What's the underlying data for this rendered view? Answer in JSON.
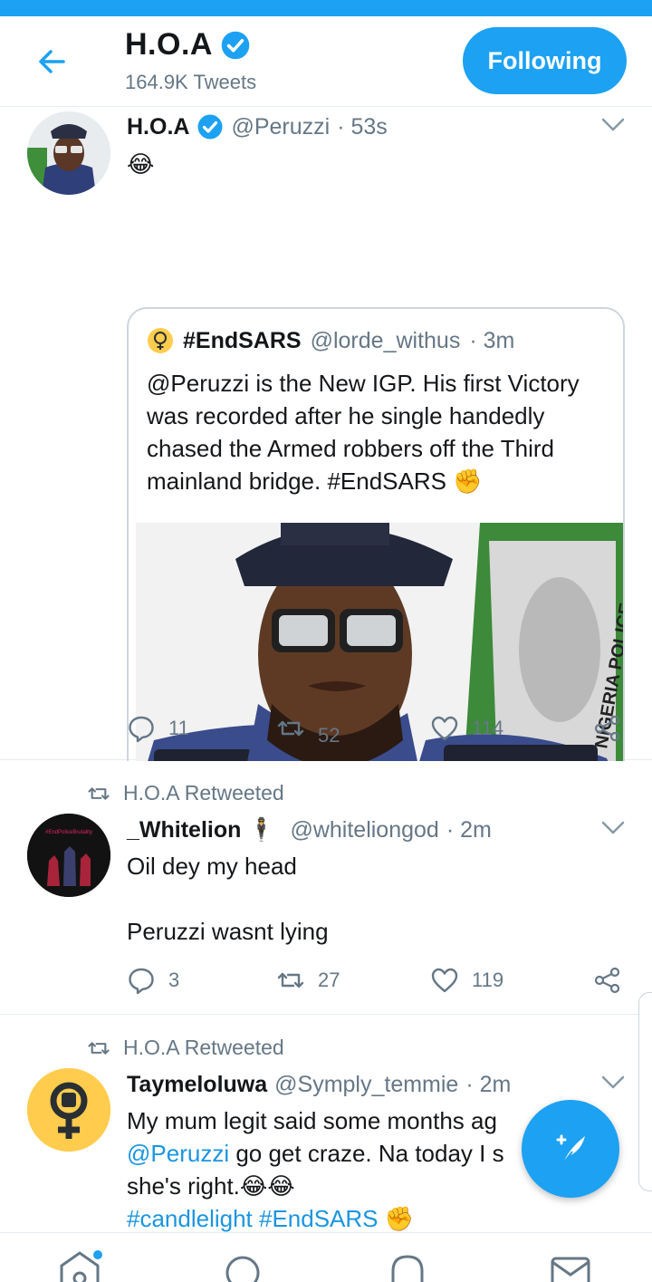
{
  "header": {
    "name": "H.O.A",
    "tweet_count": "164.9K Tweets",
    "follow_label": "Following"
  },
  "tweets": [
    {
      "name": "H.O.A",
      "handle": "@Peruzzi",
      "time": "· 53s",
      "text_emoji": "😂",
      "quote": {
        "name": "#EndSARS",
        "handle": "@lorde_withus",
        "time": "· 3m",
        "text": "@Peruzzi is the New IGP. His first Victory was recorded after he single handedly chased the Armed robbers off the Third mainland bridge. #EndSARS ✊",
        "image_text": "NIGERIA POLICE"
      },
      "replies": "11",
      "retweets": "52",
      "likes": "114"
    },
    {
      "retweeted_by": "H.O.A Retweeted",
      "name": "_Whitelion 🕴",
      "handle": "@whiteliongod",
      "time": "· 2m",
      "text_line1": "Oil dey my head",
      "text_line2": "Peruzzi wasnt lying",
      "avatar_text": "#EndPoliceBrutality",
      "replies": "3",
      "retweets": "27",
      "likes": "119"
    },
    {
      "retweeted_by": "H.O.A Retweeted",
      "name": "Taymeloluwa",
      "handle": "@Symply_temmie",
      "time": "· 2m",
      "text_line1": "My mum legit said some months ag",
      "mention": "@Peruzzi",
      "text_line2_rest": " go get craze. Na today I s",
      "text_line3": "she's right.😂😂",
      "hashtags": "#candlelight #EndSARS ✊"
    }
  ],
  "colors": {
    "accent": "#1da1f2",
    "link": "#1b95e0",
    "secondary_text": "#657786",
    "border": "#e6ecf0"
  },
  "icons": [
    "back-arrow-icon",
    "verified-icon",
    "chevron-down-icon",
    "reply-icon",
    "retweet-icon",
    "like-icon",
    "share-icon",
    "compose-icon",
    "home-icon",
    "search-icon",
    "notifications-icon",
    "messages-icon"
  ]
}
